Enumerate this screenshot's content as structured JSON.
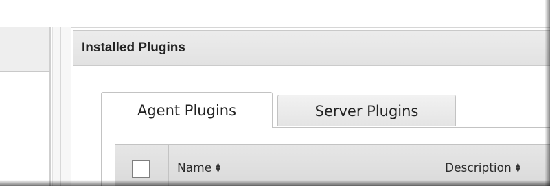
{
  "panel": {
    "title": "Installed Plugins"
  },
  "tabs": [
    {
      "label": "Agent Plugins",
      "active": true
    },
    {
      "label": "Server Plugins",
      "active": false
    }
  ],
  "table": {
    "columns": [
      {
        "label": "Name",
        "sortable": true
      },
      {
        "label": "Description",
        "sortable": true
      }
    ],
    "select_all_checked": false
  },
  "icons": {
    "sort": "sort-up-down-icon"
  }
}
